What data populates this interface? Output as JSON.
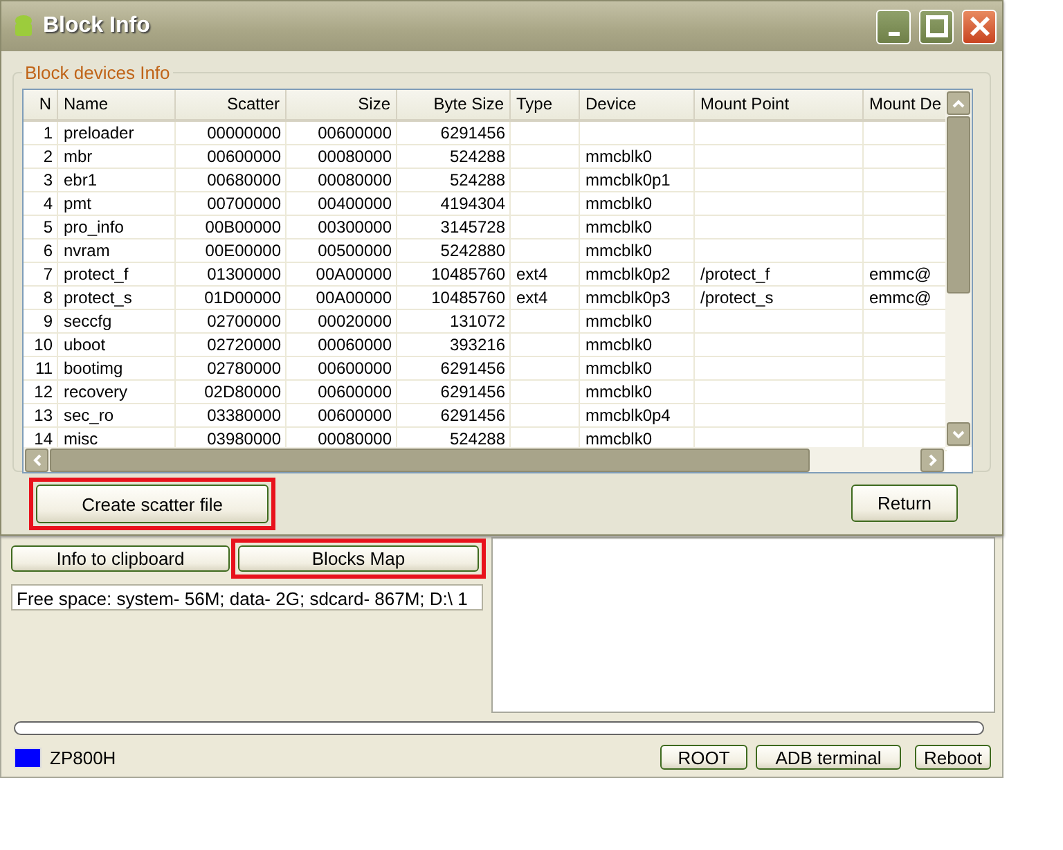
{
  "dialog": {
    "title": "Block Info",
    "group_title": "Block devices Info",
    "table": {
      "columns": [
        "N",
        "Name",
        "Scatter",
        "Size",
        "Byte Size",
        "Type",
        "Device",
        "Mount Point",
        "Mount De"
      ],
      "rows": [
        [
          "1",
          "preloader",
          "00000000",
          "00600000",
          "6291456",
          "",
          "",
          "",
          ""
        ],
        [
          "2",
          "mbr",
          "00600000",
          "00080000",
          "524288",
          "",
          "mmcblk0",
          "",
          ""
        ],
        [
          "3",
          "ebr1",
          "00680000",
          "00080000",
          "524288",
          "",
          "mmcblk0p1",
          "",
          ""
        ],
        [
          "4",
          "pmt",
          "00700000",
          "00400000",
          "4194304",
          "",
          "mmcblk0",
          "",
          ""
        ],
        [
          "5",
          "pro_info",
          "00B00000",
          "00300000",
          "3145728",
          "",
          "mmcblk0",
          "",
          ""
        ],
        [
          "6",
          "nvram",
          "00E00000",
          "00500000",
          "5242880",
          "",
          "mmcblk0",
          "",
          ""
        ],
        [
          "7",
          "protect_f",
          "01300000",
          "00A00000",
          "10485760",
          "ext4",
          "mmcblk0p2",
          "/protect_f",
          "emmc@"
        ],
        [
          "8",
          "protect_s",
          "01D00000",
          "00A00000",
          "10485760",
          "ext4",
          "mmcblk0p3",
          "/protect_s",
          "emmc@"
        ],
        [
          "9",
          "seccfg",
          "02700000",
          "00020000",
          "131072",
          "",
          "mmcblk0",
          "",
          ""
        ],
        [
          "10",
          "uboot",
          "02720000",
          "00060000",
          "393216",
          "",
          "mmcblk0",
          "",
          ""
        ],
        [
          "11",
          "bootimg",
          "02780000",
          "00600000",
          "6291456",
          "",
          "mmcblk0",
          "",
          ""
        ],
        [
          "12",
          "recovery",
          "02D80000",
          "00600000",
          "6291456",
          "",
          "mmcblk0",
          "",
          ""
        ],
        [
          "13",
          "sec_ro",
          "03380000",
          "00600000",
          "6291456",
          "",
          "mmcblk0p4",
          "",
          ""
        ],
        [
          "14",
          "misc",
          "03980000",
          "00080000",
          "524288",
          "",
          "mmcblk0",
          "",
          ""
        ]
      ]
    },
    "buttons": [
      {
        "label": "Create scatter file",
        "highlighted": true
      },
      {
        "label": "Return",
        "highlighted": false
      }
    ]
  },
  "main": {
    "buttons": [
      {
        "label": "Info to clipboard",
        "highlighted": false
      },
      {
        "label": "Blocks Map",
        "highlighted": true
      }
    ],
    "free_space": "Free space: system- 56M; data- 2G; sdcard- 867M;  D:\\ 1",
    "progress": {
      "level": 0
    },
    "device": {
      "name": "ZP800H",
      "color": "#0000ff"
    },
    "footer_buttons": [
      "ROOT",
      "ADB terminal",
      "Reboot"
    ]
  }
}
